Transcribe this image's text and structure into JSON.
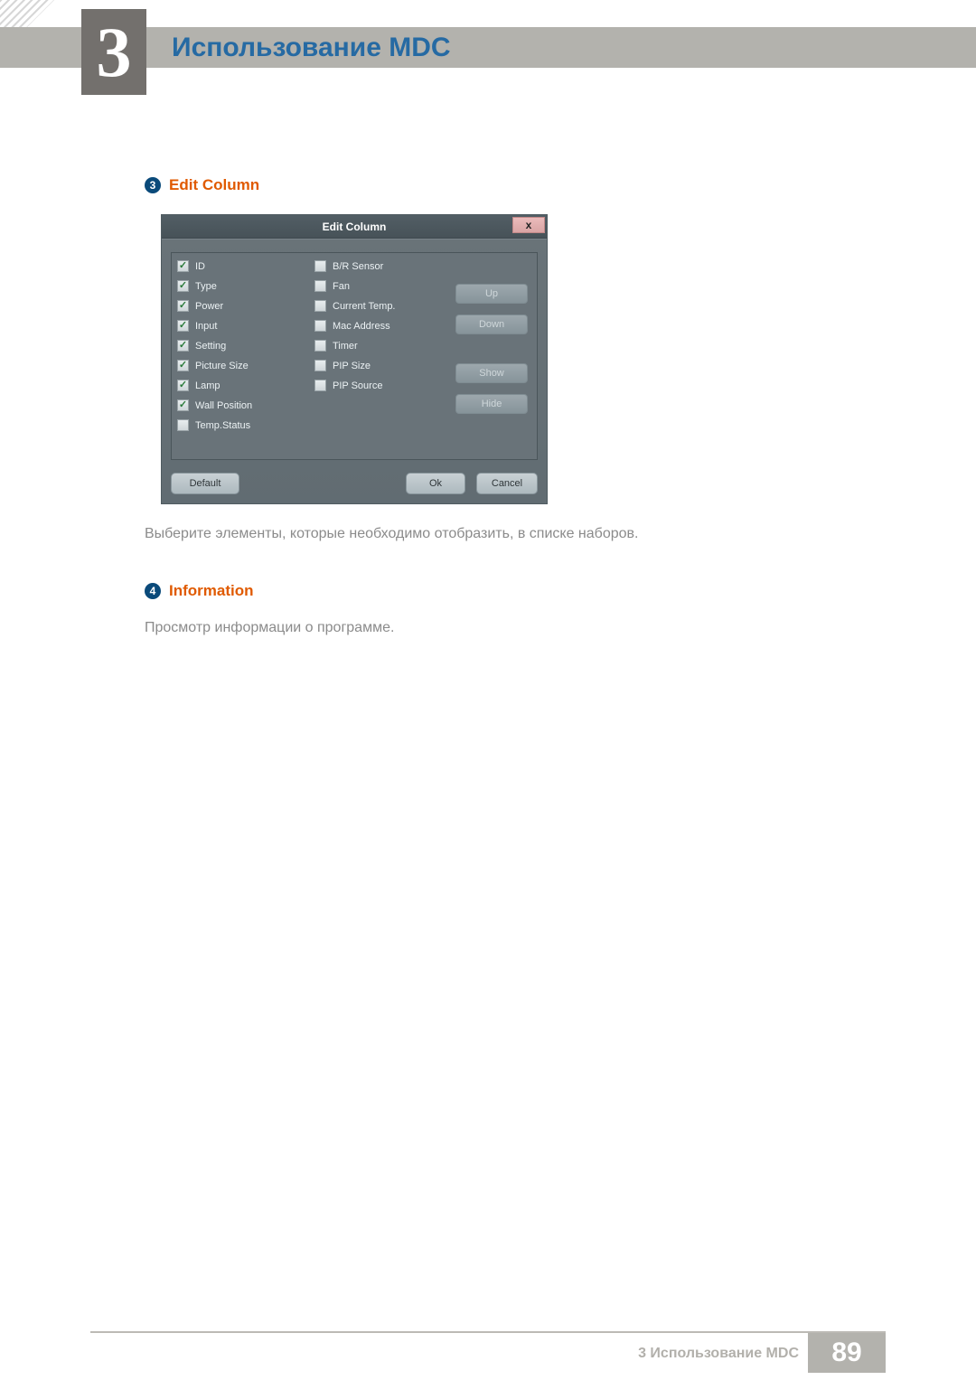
{
  "page": {
    "chapter_number": "3",
    "chapter_title": "Использование MDC"
  },
  "section1": {
    "bullet_number": "3",
    "heading": "Edit Column",
    "paragraph": "Выберите элементы, которые необходимо отобразить, в списке наборов."
  },
  "dialog": {
    "title": "Edit Column",
    "close_label": "x",
    "columns_left": [
      {
        "label": "ID",
        "checked": true
      },
      {
        "label": "Type",
        "checked": true
      },
      {
        "label": "Power",
        "checked": true
      },
      {
        "label": "Input",
        "checked": true
      },
      {
        "label": "Setting",
        "checked": true
      },
      {
        "label": "Picture Size",
        "checked": true
      },
      {
        "label": "Lamp",
        "checked": true
      },
      {
        "label": "Wall Position",
        "checked": true
      },
      {
        "label": "Temp.Status",
        "checked": false
      }
    ],
    "columns_right": [
      {
        "label": "B/R Sensor",
        "checked": false
      },
      {
        "label": "Fan",
        "checked": false
      },
      {
        "label": "Current Temp.",
        "checked": false
      },
      {
        "label": "Mac Address",
        "checked": false
      },
      {
        "label": "Timer",
        "checked": false
      },
      {
        "label": "PIP Size",
        "checked": false
      },
      {
        "label": "PIP Source",
        "checked": false
      }
    ],
    "side_buttons": {
      "up": "Up",
      "down": "Down",
      "show": "Show",
      "hide": "Hide"
    },
    "footer_buttons": {
      "default": "Default",
      "ok": "Ok",
      "cancel": "Cancel"
    }
  },
  "section2": {
    "bullet_number": "4",
    "heading": "Information",
    "paragraph": "Просмотр информации о программе."
  },
  "footer": {
    "text": "3 Использование MDC",
    "page_number": "89"
  }
}
